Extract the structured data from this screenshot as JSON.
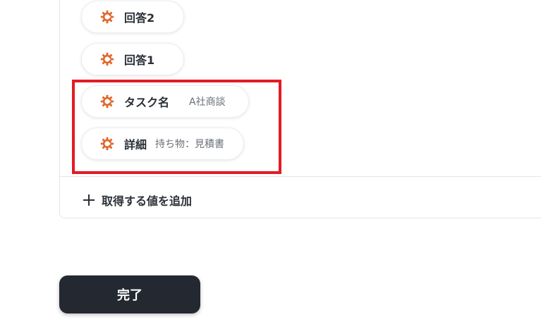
{
  "fields": [
    {
      "label": "回答2",
      "value": ""
    },
    {
      "label": "回答1",
      "value": ""
    },
    {
      "label": "タスク名",
      "value": "A社商談"
    },
    {
      "label": "詳細",
      "value": "持ち物：見積書"
    }
  ],
  "icon_color": "#e0672b",
  "highlight_color": "#e31b23",
  "add_value": {
    "label": "取得する値を追加",
    "icon": "plus-icon"
  },
  "done_button": {
    "label": "完了"
  }
}
